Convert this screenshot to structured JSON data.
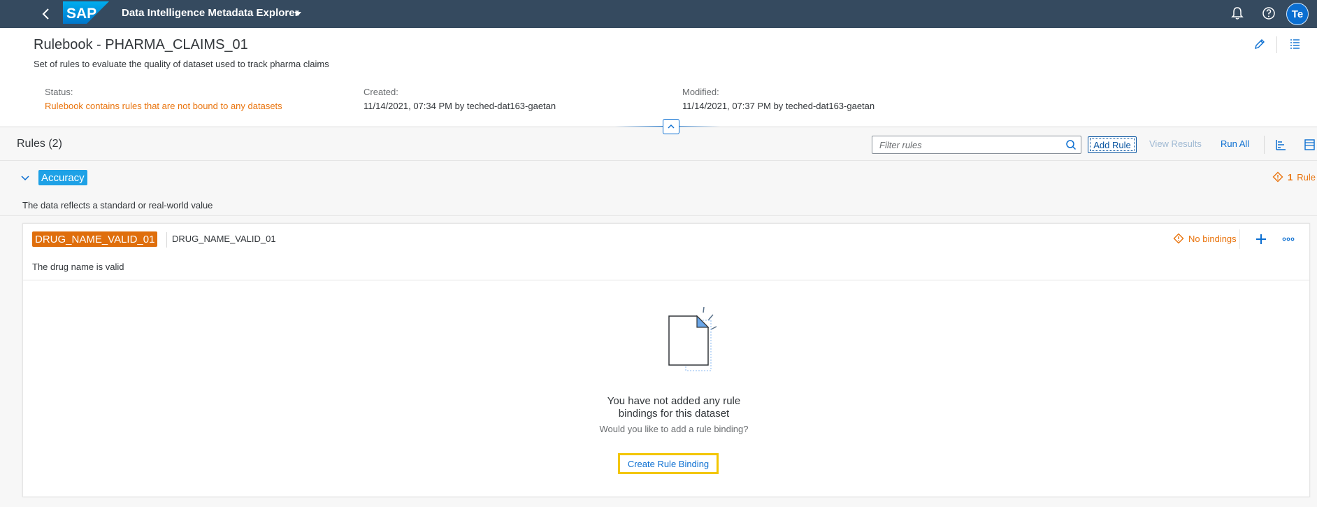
{
  "shell": {
    "app_title": "Data Intelligence Metadata Explorer",
    "logo_text": "SAP",
    "avatar_initials": "Te"
  },
  "header": {
    "title": "Rulebook - PHARMA_CLAIMS_01",
    "subtitle": "Set of rules to evaluate the quality of dataset used to track pharma claims",
    "status_label": "Status:",
    "status_value": "Rulebook contains rules that are not bound to any datasets",
    "created_label": "Created:",
    "created_value": "11/14/2021, 07:34 PM by teched-dat163-gaetan",
    "modified_label": "Modified:",
    "modified_value": "11/14/2021, 07:37 PM by teched-dat163-gaetan"
  },
  "rules_toolbar": {
    "title": "Rules (2)",
    "filter_placeholder": "Filter rules",
    "add_rule": "Add Rule",
    "view_results": "View Results",
    "run_all": "Run All"
  },
  "category": {
    "name": "Accuracy",
    "count_number": "1",
    "count_label": "Rule",
    "description": "The data reflects a standard or real-world value"
  },
  "rule": {
    "tag": "DRUG_NAME_VALID_01",
    "name": "DRUG_NAME_VALID_01",
    "bindings_status": "No bindings",
    "description": "The drug name is valid"
  },
  "empty_state": {
    "title": "You have not added any rule bindings for this dataset",
    "subtitle": "Would you like to add a rule binding?",
    "button": "Create Rule Binding"
  },
  "colors": {
    "shell_bg": "#354a5f",
    "accent": "#0a6ed1",
    "warning": "#e9730c",
    "category_tag": "#1ea1e6",
    "rule_tag": "#df6e0c",
    "highlight": "#f3c600"
  }
}
